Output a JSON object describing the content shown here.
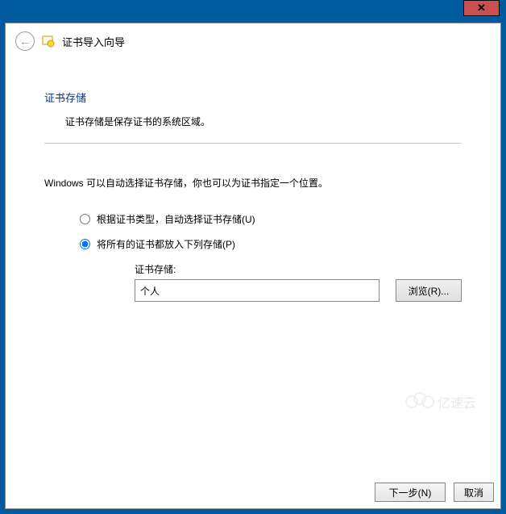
{
  "titlebar": {
    "close": "✕"
  },
  "header": {
    "back_glyph": "←",
    "title": "证书导入向导"
  },
  "content": {
    "section_title": "证书存储",
    "section_desc": "证书存储是保存证书的系统区域。",
    "instruction": "Windows 可以自动选择证书存储，你也可以为证书指定一个位置。",
    "radio_auto": "根据证书类型，自动选择证书存储(U)",
    "radio_manual": "将所有的证书都放入下列存储(P)",
    "store_label": "证书存储:",
    "store_value": "个人",
    "browse_label": "浏览(R)..."
  },
  "footer": {
    "next": "下一步(N)",
    "cancel": "取消"
  },
  "watermark": {
    "text": "亿速云"
  }
}
